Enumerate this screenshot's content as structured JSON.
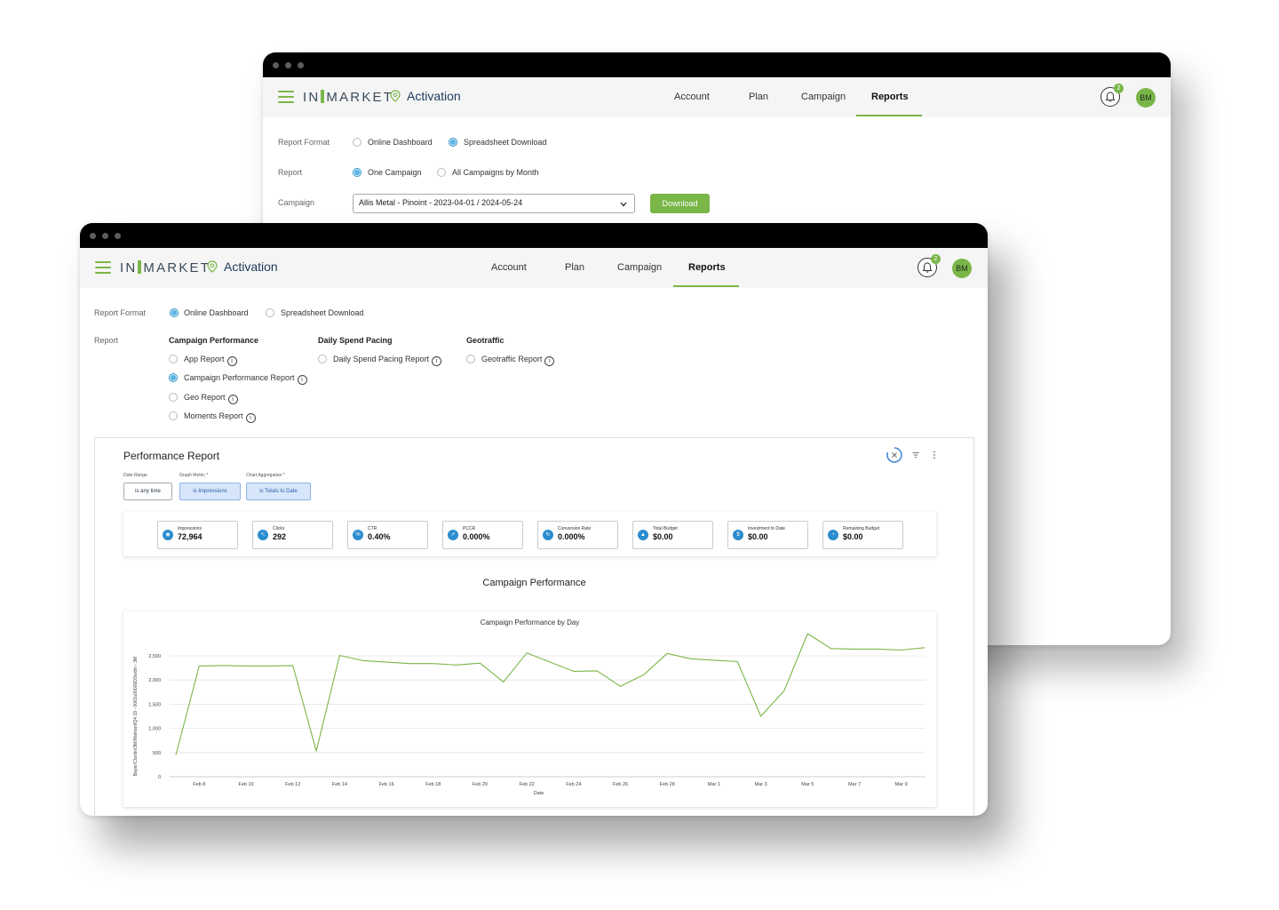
{
  "app": {
    "logo_left": "IN",
    "logo_right": "MARKET",
    "product": "Activation",
    "nav": [
      "Account",
      "Plan",
      "Campaign",
      "Reports"
    ],
    "active_nav": "Reports",
    "notification_count": "2",
    "avatar_initials": "BM"
  },
  "back_window": {
    "report_format_label": "Report Format",
    "format_options": [
      "Online Dashboard",
      "Spreadsheet Download"
    ],
    "selected_format": "Spreadsheet Download",
    "report_label": "Report",
    "report_options": [
      "One Campaign",
      "All Campaigns by Month"
    ],
    "selected_report": "One Campaign",
    "campaign_label": "Campaign",
    "campaign_value": "Allis Metal - Pinoint - 2023-04-01 / 2024-05-24",
    "download_label": "Download"
  },
  "front_window": {
    "report_format_label": "Report Format",
    "format_options": [
      "Online Dashboard",
      "Spreadsheet Download"
    ],
    "selected_format": "Online Dashboard",
    "report_label": "Report",
    "groups": [
      {
        "heading": "Campaign Performance",
        "items": [
          "App Report",
          "Campaign Performance Report",
          "Geo Report",
          "Moments Report"
        ]
      },
      {
        "heading": "Daily Spend Pacing",
        "items": [
          "Daily Spend Pacing Report"
        ]
      },
      {
        "heading": "Geotraffic",
        "items": [
          "Geotraffic Report"
        ]
      }
    ],
    "selected_report": "Campaign Performance Report",
    "info_glyph": "i",
    "panel": {
      "title": "Performance Report",
      "filters": [
        {
          "label": "Date Range",
          "value": "is any time"
        },
        {
          "label": "Graph Metric *",
          "value": "is Impressions"
        },
        {
          "label": "Chart Aggregation *",
          "value": "is Totals to Date"
        }
      ],
      "metrics": [
        {
          "label": "Impressions",
          "value": "72,964",
          "icon": "eye-icon",
          "glyph": "◉"
        },
        {
          "label": "Clicks",
          "value": "292",
          "icon": "cursor-icon",
          "glyph": "↖"
        },
        {
          "label": "CTR",
          "value": "0.40%",
          "icon": "percent-icon",
          "glyph": "%"
        },
        {
          "label": "PCCR",
          "value": "0.000%",
          "icon": "trend-icon",
          "glyph": "↗"
        },
        {
          "label": "Conversion Rate",
          "value": "0.000%",
          "icon": "conversion-icon",
          "glyph": "↻"
        },
        {
          "label": "Total Budget",
          "value": "$0.00",
          "icon": "budget-icon",
          "glyph": "▲"
        },
        {
          "label": "Investment to Date",
          "value": "$0.00",
          "icon": "dollar-icon",
          "glyph": "$"
        },
        {
          "label": "Remaining Budget",
          "value": "$0.00",
          "icon": "remaining-icon",
          "glyph": "◔"
        }
      ],
      "section_title": "Campaign Performance"
    }
  },
  "chart_data": {
    "type": "line",
    "title": "Campaign Performance by Day",
    "xlabel": "Date",
    "ylabel": "Bayer/Claritin/3M/Walmart/Q4 19 - 0063u00000DSwdm - 3M",
    "ylim": [
      0,
      2500
    ],
    "yticks": [
      0,
      500,
      1000,
      1500,
      2000,
      2500
    ],
    "ytick_labels": [
      "0",
      "500",
      "1,000",
      "1,500",
      "2,000",
      "2,500"
    ],
    "xtick_labels": [
      "Feb 8",
      "Feb 10",
      "Feb 12",
      "Feb 14",
      "Feb 16",
      "Feb 18",
      "Feb 20",
      "Feb 22",
      "Feb 24",
      "Feb 26",
      "Feb 28",
      "Mar 1",
      "Mar 3",
      "Mar 5",
      "Mar 7",
      "Mar 9"
    ],
    "xtick_index": [
      1,
      3,
      5,
      7,
      9,
      11,
      13,
      15,
      17,
      19,
      21,
      23,
      25,
      27,
      29,
      31
    ],
    "grid": true,
    "color": "#7ab648",
    "series": [
      {
        "x": [
          "Feb 7",
          "Feb 8",
          "Feb 9",
          "Feb 10",
          "Feb 11",
          "Feb 12",
          "Feb 13",
          "Feb 14",
          "Feb 15",
          "Feb 16",
          "Feb 17",
          "Feb 18",
          "Feb 19",
          "Feb 20",
          "Feb 21",
          "Feb 22",
          "Feb 23",
          "Feb 24",
          "Feb 25",
          "Feb 26",
          "Feb 27",
          "Feb 28",
          "Feb 29",
          "Mar 1",
          "Mar 2",
          "Mar 3",
          "Mar 4",
          "Mar 5",
          "Mar 6",
          "Mar 7",
          "Mar 8",
          "Mar 9",
          "Mar 10"
        ],
        "values": [
          450,
          2290,
          2300,
          2290,
          2290,
          2300,
          530,
          2510,
          2400,
          2370,
          2340,
          2340,
          2310,
          2350,
          1960,
          2560,
          2370,
          2180,
          2190,
          1870,
          2110,
          2550,
          2440,
          2410,
          2380,
          1250,
          1780,
          2960,
          2650,
          2640,
          2640,
          2620,
          2670
        ]
      }
    ]
  }
}
